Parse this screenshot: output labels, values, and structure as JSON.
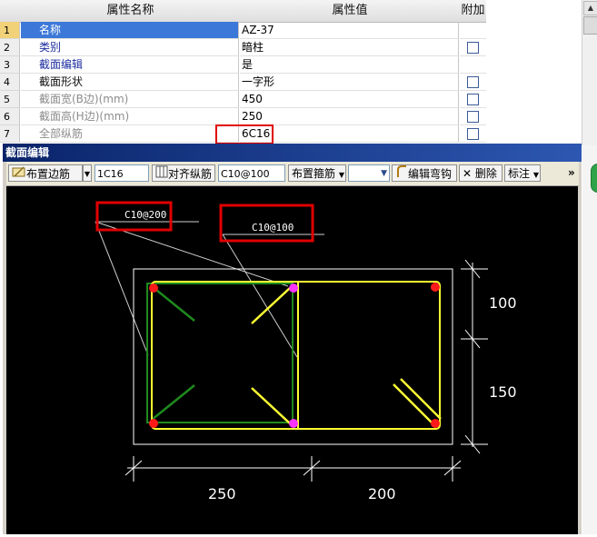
{
  "grid": {
    "headers": {
      "name": "属性名称",
      "value": "属性值",
      "attach": "附加"
    },
    "rows": [
      {
        "num": "1",
        "name": "名称",
        "value": "AZ-37",
        "color": "selected",
        "checkbox": false
      },
      {
        "num": "2",
        "name": "类别",
        "value": "暗柱",
        "color": "blue",
        "checkbox": true
      },
      {
        "num": "3",
        "name": "截面编辑",
        "value": "是",
        "color": "blue",
        "checkbox": false
      },
      {
        "num": "4",
        "name": "截面形状",
        "value": "一字形",
        "color": "black",
        "checkbox": true
      },
      {
        "num": "5",
        "name": "截面宽(B边)(mm)",
        "value": "450",
        "color": "gray",
        "checkbox": true
      },
      {
        "num": "6",
        "name": "截面高(H边)(mm)",
        "value": "250",
        "color": "gray",
        "checkbox": true
      },
      {
        "num": "7",
        "name": "全部纵筋",
        "value": "6C16",
        "color": "gray",
        "checkbox": true
      }
    ]
  },
  "editor": {
    "title": "截面编辑",
    "toolbar": {
      "place_edge_rebar": "布置边筋",
      "rebar_input": "1C16",
      "align_rebar": "对齐纵筋",
      "stirrup_input": "C10@100",
      "place_stirrup": "布置箍筋",
      "edit_hook": "编辑弯钩",
      "delete": "删除",
      "annotate": "标注",
      "overflow": "»"
    },
    "canvas": {
      "labels": {
        "stirrup_left": "C10@200",
        "stirrup_right": "C10@100"
      },
      "dims": {
        "right_top": "100",
        "right_bottom": "150",
        "bottom_left": "250",
        "bottom_right": "200"
      },
      "colors": {
        "outline": "#ffffff",
        "stirrup_yellow": "#ffff33",
        "stirrup_green": "#1e8a1e",
        "rebar_red": "#ff1a1a",
        "rebar_magenta": "#ff33ff",
        "highlight_red": "#e00000"
      }
    }
  }
}
